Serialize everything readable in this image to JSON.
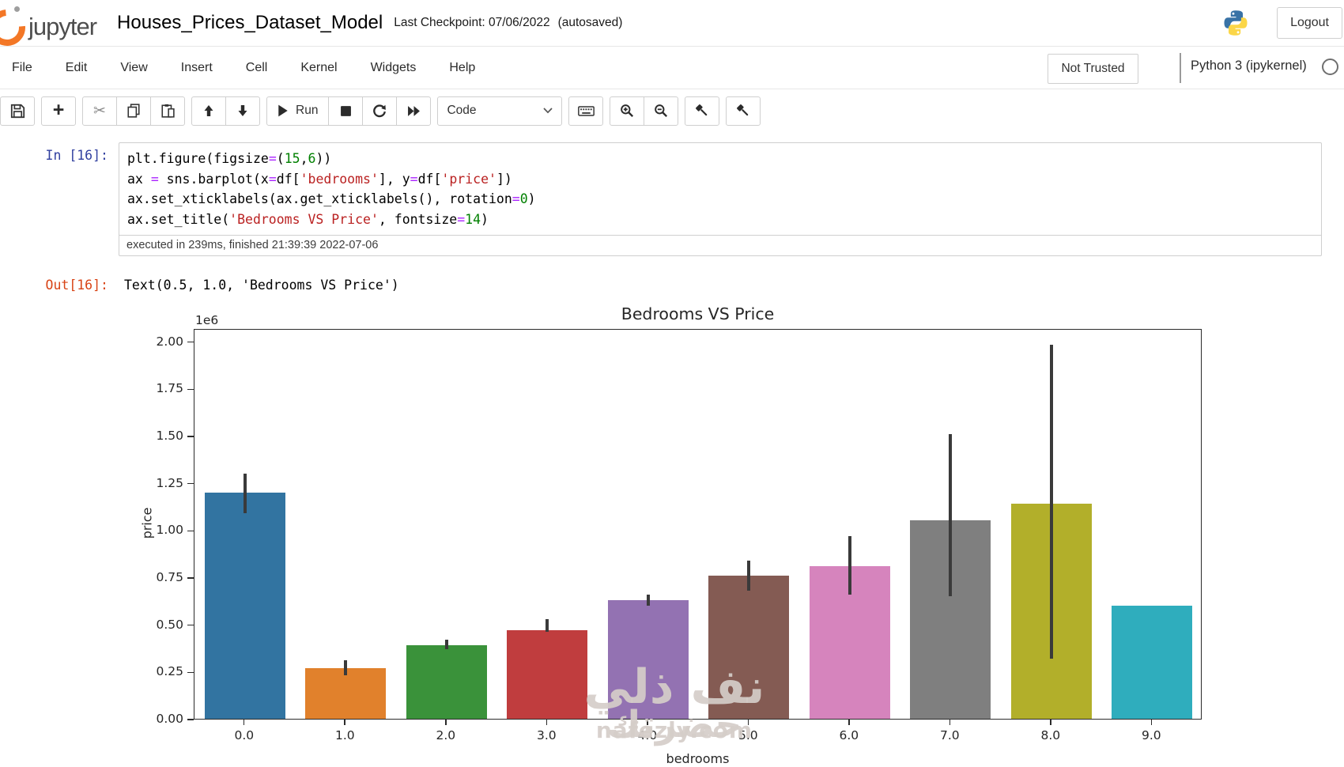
{
  "header": {
    "brand": "jupyter",
    "title": "Houses_Prices_Dataset_Model",
    "checkpoint": "Last Checkpoint: 07/06/2022",
    "autosaved": "(autosaved)",
    "logout_label": "Logout"
  },
  "menu": {
    "items": [
      "File",
      "Edit",
      "View",
      "Insert",
      "Cell",
      "Kernel",
      "Widgets",
      "Help"
    ],
    "trust_status": "Not Trusted",
    "kernel_name": "Python 3 (ipykernel)"
  },
  "toolbar": {
    "run_label": "Run",
    "cell_type": "Code",
    "icons": [
      "save-icon",
      "add-cell-icon",
      "cut-cell-icon",
      "copy-cell-icon",
      "paste-cell-icon",
      "move-up-icon",
      "move-down-icon",
      "run-icon",
      "interrupt-kernel-icon",
      "restart-kernel-icon",
      "restart-run-all-icon",
      "keyboard-icon",
      "zoom-in-icon",
      "zoom-out-icon",
      "gavel-icon",
      "gavel-icon"
    ]
  },
  "cell": {
    "in_prompt": "In [16]:",
    "out_prompt": "Out[16]:",
    "execution_note": "executed in 239ms, finished 21:39:39 2022-07-06",
    "output_text": "Text(0.5, 1.0, 'Bedrooms VS Price')",
    "code_lines": [
      [
        [
          "d",
          "plt.figure(figsize"
        ],
        [
          "o",
          "="
        ],
        [
          "d",
          "("
        ],
        [
          "n",
          "15"
        ],
        [
          "d",
          ","
        ],
        [
          "n",
          "6"
        ],
        [
          "d",
          "))"
        ]
      ],
      [
        [
          "d",
          "ax "
        ],
        [
          "o",
          "="
        ],
        [
          "d",
          " sns.barplot(x"
        ],
        [
          "o",
          "="
        ],
        [
          "d",
          "df["
        ],
        [
          "s",
          "'bedrooms'"
        ],
        [
          "d",
          "], y"
        ],
        [
          "o",
          "="
        ],
        [
          "d",
          "df["
        ],
        [
          "s",
          "'price'"
        ],
        [
          "d",
          "])"
        ]
      ],
      [
        [
          "d",
          "ax.set_xticklabels(ax.get_xticklabels(), rotation"
        ],
        [
          "o",
          "="
        ],
        [
          "n",
          "0"
        ],
        [
          "d",
          ")"
        ]
      ],
      [
        [
          "d",
          "ax.set_title("
        ],
        [
          "s",
          "'Bedrooms VS Price'"
        ],
        [
          "d",
          ", fontsize"
        ],
        [
          "o",
          "="
        ],
        [
          "n",
          "14"
        ],
        [
          "d",
          ")"
        ]
      ]
    ]
  },
  "watermark": {
    "line1": "نف ذلي",
    "line2": "حضرتك",
    "line3": "nafezly.com"
  },
  "chart_data": {
    "type": "bar",
    "title": "Bedrooms VS Price",
    "xlabel": "bedrooms",
    "ylabel": "price",
    "offset_label": "1e6",
    "unit": "1e6",
    "categories": [
      "0.0",
      "1.0",
      "2.0",
      "3.0",
      "4.0",
      "5.0",
      "6.0",
      "7.0",
      "8.0",
      "9.0"
    ],
    "values": [
      1.2,
      0.27,
      0.39,
      0.47,
      0.63,
      0.76,
      0.81,
      1.05,
      1.14,
      0.6
    ],
    "err_low": [
      1.09,
      0.23,
      0.37,
      0.46,
      0.6,
      0.68,
      0.66,
      0.65,
      0.32,
      null
    ],
    "err_high": [
      1.3,
      0.31,
      0.42,
      0.53,
      0.66,
      0.84,
      0.97,
      1.51,
      1.98,
      null
    ],
    "bar_colors": [
      "#3274a1",
      "#e1812c",
      "#3a923a",
      "#c03d3e",
      "#9372b2",
      "#845b53",
      "#d684bd",
      "#7f7f7f",
      "#b2af2a",
      "#2fadbd"
    ],
    "error_bar_color": "#3a3a3a",
    "ylim": [
      0,
      2.07
    ],
    "ytick_values": [
      0.0,
      0.25,
      0.5,
      0.75,
      1.0,
      1.25,
      1.5,
      1.75,
      2.0
    ],
    "ytick_labels": [
      "0.00",
      "0.25",
      "0.50",
      "0.75",
      "1.00",
      "1.25",
      "1.50",
      "1.75",
      "2.00"
    ],
    "grid": false,
    "legend": null
  }
}
